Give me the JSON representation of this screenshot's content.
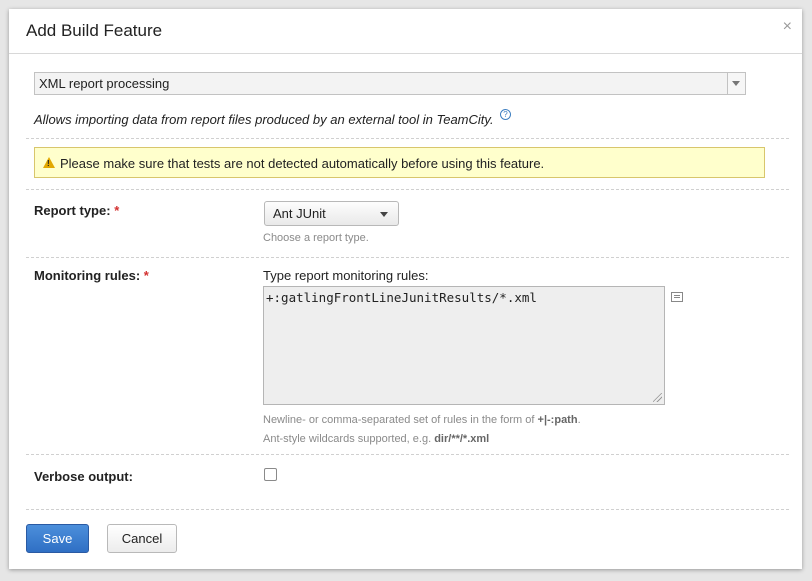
{
  "dialog": {
    "title": "Add Build Feature",
    "close_glyph": "×"
  },
  "feature_select": {
    "value": "XML report processing"
  },
  "description": {
    "text": "Allows importing data from report files produced by an external tool in TeamCity.",
    "help_glyph": "?"
  },
  "warning": {
    "text": "Please make sure that tests are not detected automatically before using this feature.",
    "icon_glyph": "!",
    "background": "#ffffcc"
  },
  "report_type": {
    "label": "Report type:",
    "required_mark": "*",
    "selected": "Ant JUnit",
    "hint": "Choose a report type."
  },
  "monitoring_rules": {
    "label": "Monitoring rules:",
    "required_mark": "*",
    "caption": "Type report monitoring rules:",
    "value": "+:gatlingFrontLineJunitResults/*.xml",
    "hint_line1_prefix": "Newline- or comma-separated set of rules in the form of ",
    "hint_line1_code": "+|-:path",
    "hint_line1_suffix": ".",
    "hint_line2_prefix": "Ant-style wildcards supported, e.g. ",
    "hint_line2_code": "dir/**/*.xml"
  },
  "verbose_output": {
    "label": "Verbose output:",
    "checked": false
  },
  "buttons": {
    "save": "Save",
    "cancel": "Cancel"
  },
  "colors": {
    "accent": "#3a7bd5",
    "required": "#d3302f",
    "warning_border": "#d8c66c"
  }
}
